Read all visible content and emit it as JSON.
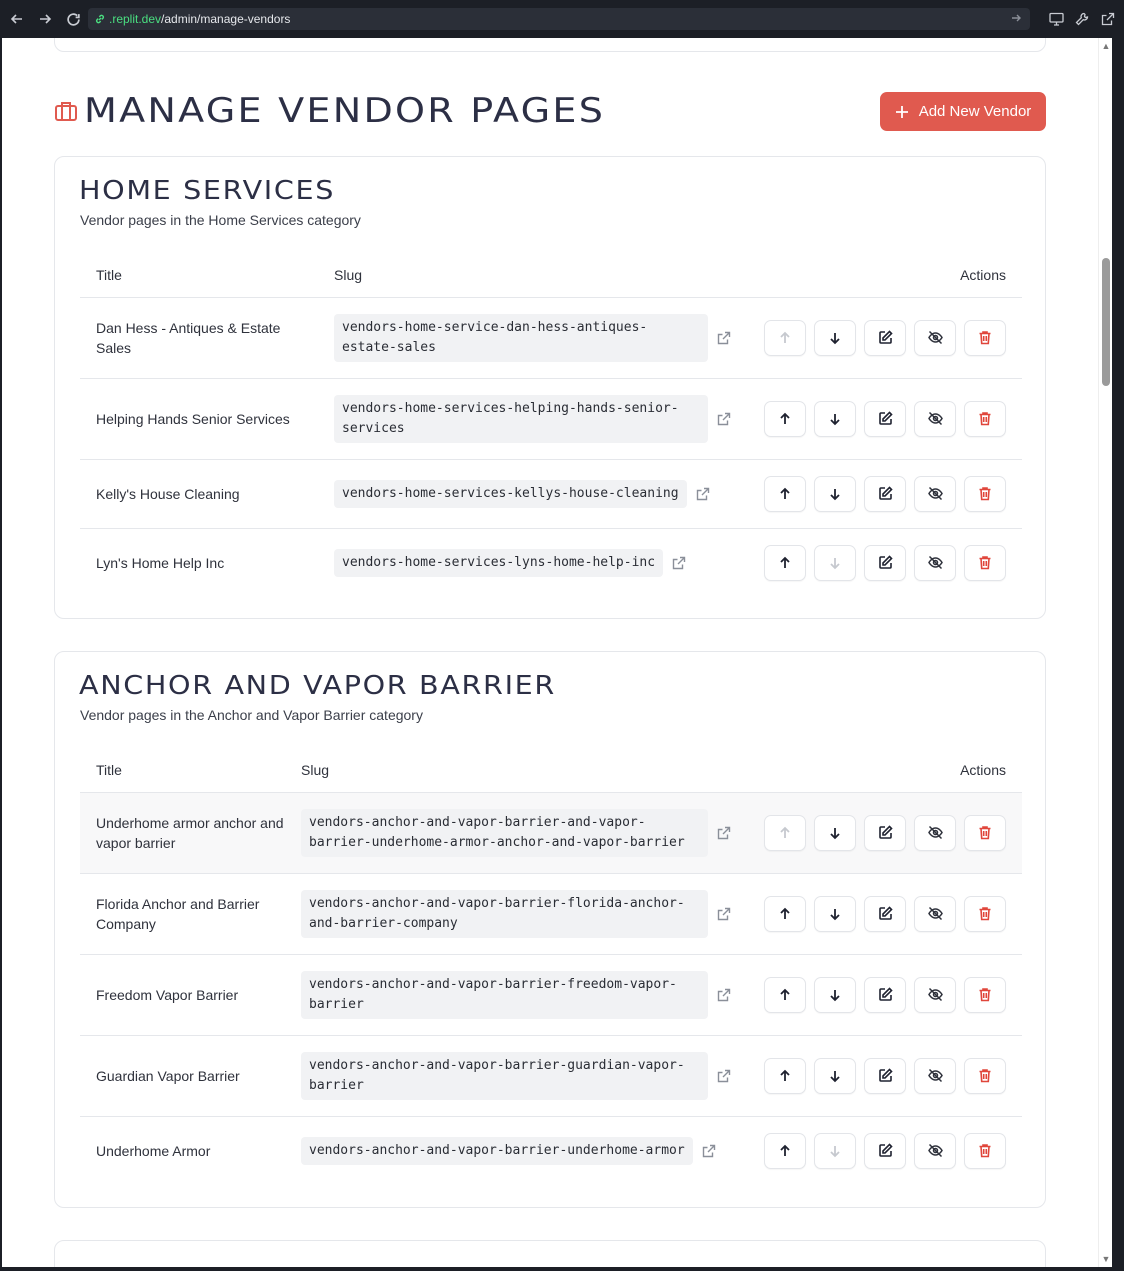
{
  "browser": {
    "url_host": ".replit.dev",
    "url_path": "/admin/manage-vendors"
  },
  "header": {
    "title": "Manage Vendor Pages",
    "add_button": "Add New Vendor",
    "icon": "briefcase-icon"
  },
  "columns": {
    "title": "Title",
    "slug": "Slug",
    "actions": "Actions"
  },
  "sections": [
    {
      "name": "Home Services",
      "description": "Vendor pages in the Home Services category",
      "rows": [
        {
          "title": "Dan Hess - Antiques & Estate Sales",
          "slug": "vendors-home-service-dan-hess-antiques-estate-sales",
          "up_disabled": true,
          "down_disabled": false
        },
        {
          "title": "Helping Hands Senior Services",
          "slug": "vendors-home-services-helping-hands-senior-services",
          "up_disabled": false,
          "down_disabled": false
        },
        {
          "title": "Kelly's House Cleaning",
          "slug": "vendors-home-services-kellys-house-cleaning",
          "up_disabled": false,
          "down_disabled": false
        },
        {
          "title": "Lyn's Home Help Inc",
          "slug": "vendors-home-services-lyns-home-help-inc",
          "up_disabled": false,
          "down_disabled": true
        }
      ]
    },
    {
      "name": "Anchor and Vapor Barrier",
      "description": "Vendor pages in the Anchor and Vapor Barrier category",
      "rows": [
        {
          "title": "Underhome armor anchor and vapor barrier",
          "slug": "vendors-anchor-and-vapor-barrier-and-vapor-barrier-underhome-armor-anchor-and-vapor-barrier",
          "up_disabled": true,
          "down_disabled": false
        },
        {
          "title": "Florida Anchor and Barrier Company",
          "slug": "vendors-anchor-and-vapor-barrier-florida-anchor-and-barrier-company",
          "up_disabled": false,
          "down_disabled": false
        },
        {
          "title": "Freedom Vapor Barrier",
          "slug": "vendors-anchor-and-vapor-barrier-freedom-vapor-barrier",
          "up_disabled": false,
          "down_disabled": false
        },
        {
          "title": "Guardian Vapor Barrier",
          "slug": "vendors-anchor-and-vapor-barrier-guardian-vapor-barrier",
          "up_disabled": false,
          "down_disabled": false
        },
        {
          "title": "Underhome Armor",
          "slug": "vendors-anchor-and-vapor-barrier-underhome-armor",
          "up_disabled": false,
          "down_disabled": true
        }
      ]
    }
  ],
  "colors": {
    "accent": "#e05a4f",
    "heading": "#2c2f45",
    "delete": "#e0463b"
  }
}
